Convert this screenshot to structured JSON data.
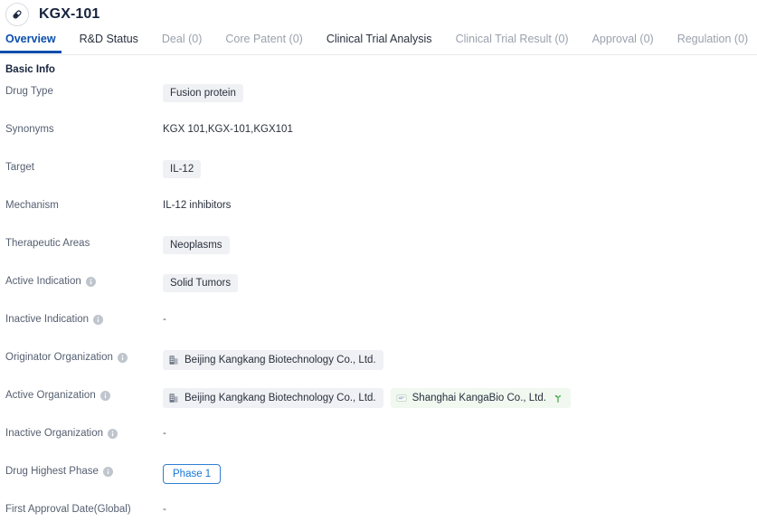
{
  "header": {
    "icon": "pill-capsule-icon",
    "title": "KGX-101"
  },
  "tabs": [
    {
      "label": "Overview",
      "state": "active"
    },
    {
      "label": "R&D Status",
      "state": "enabled"
    },
    {
      "label": "Deal (0)",
      "state": "disabled"
    },
    {
      "label": "Core Patent (0)",
      "state": "disabled"
    },
    {
      "label": "Clinical Trial Analysis",
      "state": "enabled"
    },
    {
      "label": "Clinical Trial Result (0)",
      "state": "disabled"
    },
    {
      "label": "Approval (0)",
      "state": "disabled"
    },
    {
      "label": "Regulation (0)",
      "state": "disabled"
    }
  ],
  "basic_info": {
    "section_title": "Basic Info",
    "rows": [
      {
        "label": "Drug Type",
        "has_info_icon": false,
        "type": "chips",
        "chips": [
          {
            "text": "Fusion protein"
          }
        ]
      },
      {
        "label": "Synonyms",
        "has_info_icon": false,
        "type": "text",
        "text": "KGX 101,KGX-101,KGX101"
      },
      {
        "label": "Target",
        "has_info_icon": false,
        "type": "chips",
        "chips": [
          {
            "text": "IL-12"
          }
        ]
      },
      {
        "label": "Mechanism",
        "has_info_icon": false,
        "type": "text",
        "text": "IL-12 inhibitors"
      },
      {
        "label": "Therapeutic Areas",
        "has_info_icon": false,
        "type": "chips",
        "chips": [
          {
            "text": "Neoplasms"
          }
        ]
      },
      {
        "label": "Active Indication",
        "has_info_icon": true,
        "type": "chips",
        "chips": [
          {
            "text": "Solid Tumors"
          }
        ]
      },
      {
        "label": "Inactive Indication",
        "has_info_icon": true,
        "type": "empty",
        "text": "-"
      },
      {
        "label": "Originator Organization",
        "has_info_icon": true,
        "type": "orgs",
        "orgs": [
          {
            "text": "Beijing Kangkang Biotechnology Co., Ltd.",
            "icon": "company-building-icon",
            "style": "gray",
            "badge_icon": null
          }
        ]
      },
      {
        "label": "Active Organization",
        "has_info_icon": true,
        "type": "orgs",
        "orgs": [
          {
            "text": "Beijing Kangkang Biotechnology Co., Ltd.",
            "icon": "company-building-icon",
            "style": "gray",
            "badge_icon": null
          },
          {
            "text": "Shanghai KangaBio Co., Ltd.",
            "icon": "company-card-icon",
            "style": "green",
            "badge_icon": "green-sprout-icon"
          }
        ]
      },
      {
        "label": "Inactive Organization",
        "has_info_icon": true,
        "type": "empty",
        "text": "-"
      },
      {
        "label": "Drug Highest Phase",
        "has_info_icon": true,
        "type": "phase",
        "phase": "Phase 1"
      },
      {
        "label": "First Approval Date(Global)",
        "has_info_icon": false,
        "type": "empty",
        "text": "-"
      }
    ]
  },
  "colors": {
    "accent_blue": "#0b4eab",
    "phase_blue": "#1676d6",
    "chip_gray": "#f0f1f4",
    "chip_green": "#f0f8f0",
    "sprout_green": "#3a9a3a",
    "label_gray": "#566071",
    "disabled_tab": "#9aa1ad"
  }
}
